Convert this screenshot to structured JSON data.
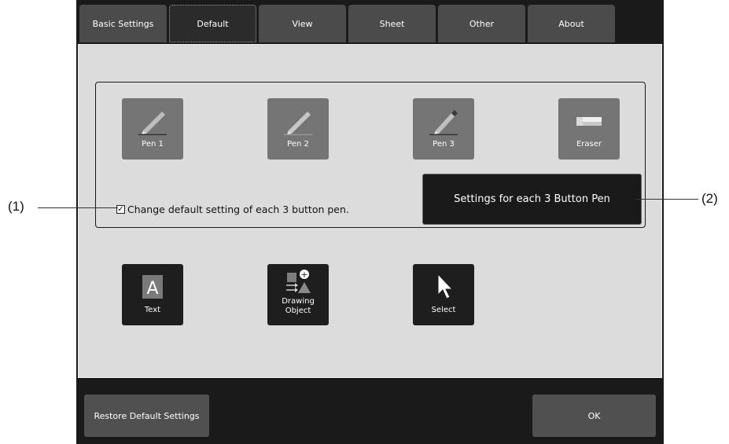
{
  "tabs": [
    {
      "label": "Basic Settings",
      "active": false
    },
    {
      "label": "Default",
      "active": true
    },
    {
      "label": "View",
      "active": false
    },
    {
      "label": "Sheet",
      "active": false
    },
    {
      "label": "Other",
      "active": false
    },
    {
      "label": "About",
      "active": false
    }
  ],
  "pen_tools": [
    {
      "label": "Pen 1",
      "icon": "pen-icon"
    },
    {
      "label": "Pen 2",
      "icon": "pen-icon"
    },
    {
      "label": "Pen 3",
      "icon": "pen-icon"
    },
    {
      "label": "Eraser",
      "icon": "eraser-icon"
    }
  ],
  "checkbox": {
    "label": "Change default setting of each 3 button pen.",
    "checked": true,
    "mark": "✓"
  },
  "settings_button": {
    "label": "Settings for each 3 Button Pen"
  },
  "other_tools": [
    {
      "label": "Text",
      "icon": "text-icon"
    },
    {
      "label": "Drawing Object",
      "line1": "Drawing",
      "line2": "Object",
      "icon": "shapes-icon"
    },
    {
      "label": "Select",
      "icon": "cursor-icon"
    }
  ],
  "footer": {
    "restore_label": "Restore Default Settings",
    "ok_label": "OK"
  },
  "callouts": {
    "left": "(1)",
    "right": "(2)"
  },
  "colors": {
    "frame": "#1a1a1a",
    "tab": "#4b4b4b",
    "content_bg": "#dcdcdc",
    "tool_gray": "#757575",
    "tool_dark": "#1e1e1e"
  }
}
